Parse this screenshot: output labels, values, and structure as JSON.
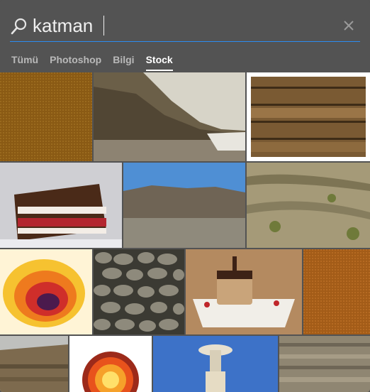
{
  "search": {
    "query": "katman",
    "icon": "search-icon",
    "clear_icon": "close-icon"
  },
  "tabs": [
    {
      "label": "Tümü",
      "active": false
    },
    {
      "label": "Photoshop",
      "active": false
    },
    {
      "label": "Bilgi",
      "active": false
    },
    {
      "label": "Stock",
      "active": true
    }
  ],
  "colors": {
    "panel_bg": "#535353",
    "accent_underline": "#2c8cf0",
    "active_tab": "#ffffff",
    "inactive_tab": "#b9b9b9"
  },
  "results": [
    {
      "subject": "brown fabric texture"
    },
    {
      "subject": "coastal cliff and pebble beach"
    },
    {
      "subject": "weathered wood planks"
    },
    {
      "subject": "layered chocolate cake slice"
    },
    {
      "subject": "rocky hill under blue sky"
    },
    {
      "subject": "rock strata with vegetation"
    },
    {
      "subject": "colorful layered heat map"
    },
    {
      "subject": "stone wall"
    },
    {
      "subject": "chocolate dessert on plate"
    },
    {
      "subject": "orange fabric texture"
    },
    {
      "subject": "sediment cliff"
    },
    {
      "subject": "earth layers diagram"
    },
    {
      "subject": "rock formation hoodoo"
    },
    {
      "subject": "layered sandstone"
    }
  ]
}
